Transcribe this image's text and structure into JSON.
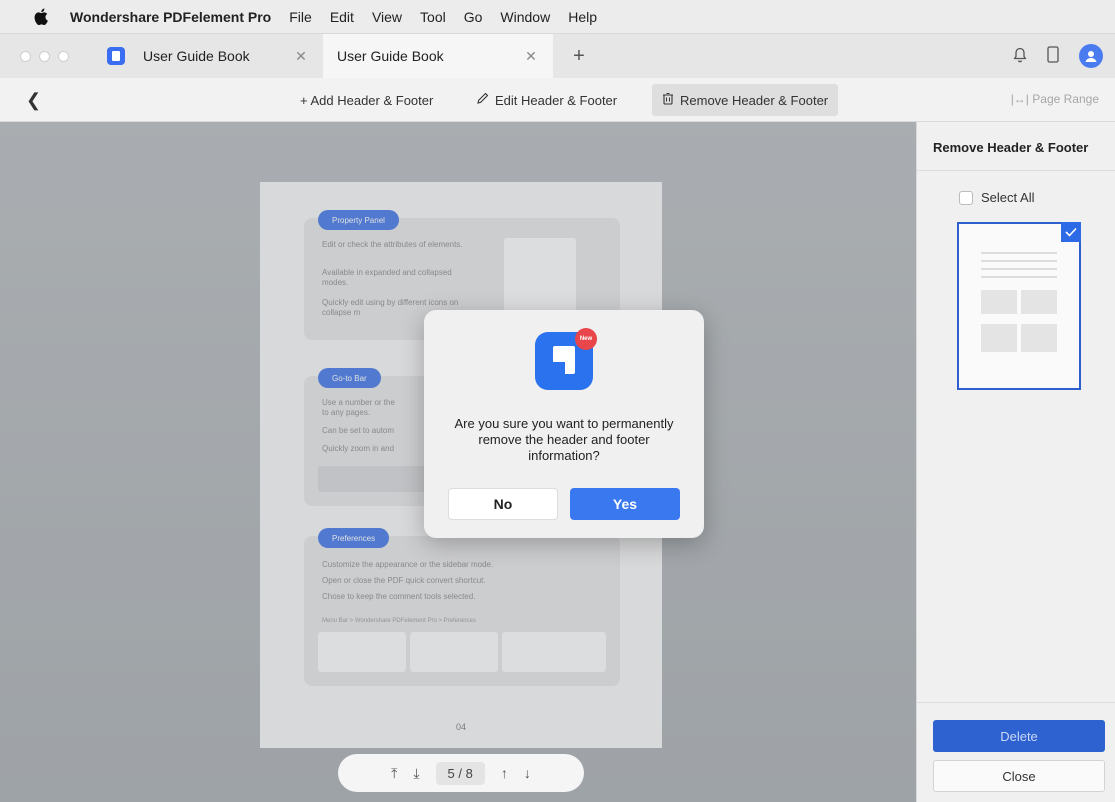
{
  "menubar": {
    "app_name": "Wondershare PDFelement Pro",
    "items": [
      "File",
      "Edit",
      "View",
      "Tool",
      "Go",
      "Window",
      "Help"
    ]
  },
  "tabs": [
    {
      "label": "User Guide Book",
      "active": false
    },
    {
      "label": "User Guide Book",
      "active": true
    }
  ],
  "toolbar": {
    "add_label": "+ Add Header & Footer",
    "edit_label": "Edit Header & Footer",
    "remove_label": "Remove Header & Footer",
    "page_range_label": "Page Range"
  },
  "document": {
    "section1": {
      "title": "Property Panel",
      "bullets": [
        "Edit or check the attributes of elements.",
        "Available in expanded and collapsed modes.",
        "Quickly edit using by different icons on collapse m"
      ]
    },
    "section2": {
      "title": "Go-to Bar",
      "bullets": [
        "Use a number or the",
        "to any pages.",
        "Can be set to autom",
        "Quickly zoom in and"
      ]
    },
    "section3": {
      "title": "Preferences",
      "bullets": [
        "Customize the appearance or the sidebar mode.",
        "Open or close the PDF quick convert shortcut.",
        "Chose to keep the comment tools selected."
      ],
      "path": "Menu Bar > Wondershare PDFelement Pro > Preferences"
    },
    "page_number": "04"
  },
  "pagenav": {
    "current": "5",
    "separator": "/",
    "total": "8"
  },
  "dialog": {
    "badge": "New",
    "message": "Are you sure you want to permanently remove the header and footer information?",
    "no_label": "No",
    "yes_label": "Yes"
  },
  "panel": {
    "title": "Remove Header & Footer",
    "select_all": "Select All",
    "delete_label": "Delete",
    "close_label": "Close"
  },
  "colors": {
    "accent": "#3a78ef",
    "thumb_border": "#2d5fcf"
  }
}
